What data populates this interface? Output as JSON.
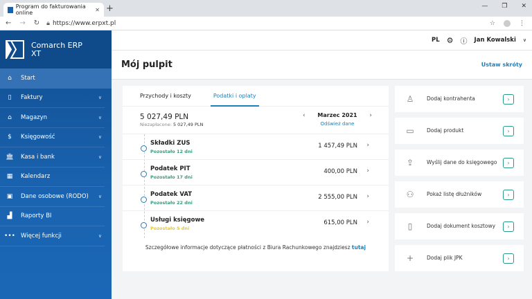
{
  "browser": {
    "tab_title": "Program do fakturowania online",
    "url": "https://www.erpxt.pl"
  },
  "app": {
    "logo_line1": "Comarch ERP",
    "logo_line2": "XT"
  },
  "sidebar": {
    "items": [
      {
        "label": "Start",
        "icon": "home-icon",
        "chevron": false,
        "active": true
      },
      {
        "label": "Faktury",
        "icon": "document-icon",
        "chevron": true
      },
      {
        "label": "Magazyn",
        "icon": "warehouse-icon",
        "chevron": true
      },
      {
        "label": "Księgowość",
        "icon": "accounting-icon",
        "chevron": true
      },
      {
        "label": "Kasa i bank",
        "icon": "bank-icon",
        "chevron": true
      },
      {
        "label": "Kalendarz",
        "icon": "calendar-icon",
        "chevron": false
      },
      {
        "label": "Dane osobowe (RODO)",
        "icon": "id-card-icon",
        "chevron": true
      },
      {
        "label": "Raporty BI",
        "icon": "bar-chart-icon",
        "chevron": false
      },
      {
        "label": "Więcej funkcji",
        "icon": "more-icon",
        "chevron": true
      }
    ]
  },
  "topbar": {
    "lang": "PL",
    "user": "Jan Kowalski"
  },
  "page": {
    "title": "Mój pulpit",
    "shortcuts_link": "Ustaw skróty"
  },
  "card": {
    "tabs": [
      {
        "label": "Przychody i koszty"
      },
      {
        "label": "Podatki i oplaty",
        "active": true
      }
    ],
    "total": "5 027,49 PLN",
    "unpaid_label": "Niezapłacone:",
    "unpaid_value": "5 027,49 PLN",
    "month": "Marzec 2021",
    "refresh": "Odśwież dane",
    "rows": [
      {
        "name": "Składki ZUS",
        "due": "Pozostało 12 dni",
        "amount": "1 457,49 PLN",
        "status_color": "#3a9a7e"
      },
      {
        "name": "Podatek PIT",
        "due": "Pozostało 17 dni",
        "amount": "400,00 PLN",
        "status_color": "#3a9a7e"
      },
      {
        "name": "Podatek VAT",
        "due": "Pozostało 22 dni",
        "amount": "2 555,00 PLN",
        "status_color": "#3a9a7e"
      },
      {
        "name": "Usługi księgowe",
        "due": "Pozostało 5 dni",
        "amount": "615,00 PLN",
        "status_color": "#e8c830"
      }
    ],
    "footer_text": "Szczegółowe informacje dotyczące płatności z Biura Rachunkowego znajdziesz",
    "footer_link": "tutaj"
  },
  "shortcuts": [
    {
      "label": "Dodaj kontrahenta",
      "icon": "user-icon"
    },
    {
      "label": "Dodaj produkt",
      "icon": "bag-icon"
    },
    {
      "label": "Wyślij dane do księgowego",
      "icon": "share-icon"
    },
    {
      "label": "Pokaż listę dłużników",
      "icon": "users-icon"
    },
    {
      "label": "Dodaj dokument kosztowy",
      "icon": "document-icon"
    },
    {
      "label": "Dodaj plik JPK",
      "icon": "plus-icon"
    }
  ]
}
